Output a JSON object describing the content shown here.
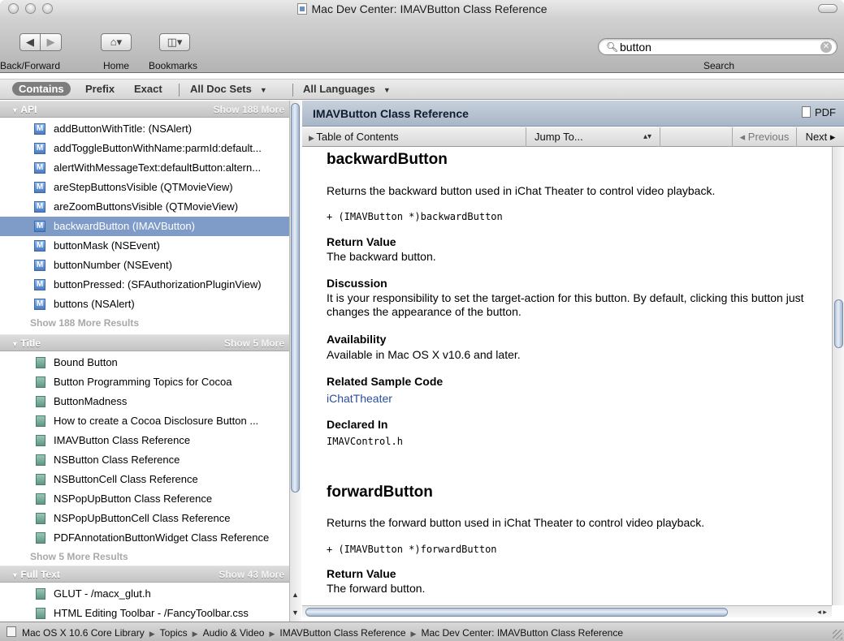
{
  "window": {
    "title": "Mac Dev Center: IMAVButton Class Reference"
  },
  "toolbar": {
    "back_forward_label": "Back/Forward",
    "home_label": "Home",
    "bookmarks_label": "Bookmarks",
    "search_label": "Search",
    "search_value": "button"
  },
  "filters": {
    "contains": "Contains",
    "prefix": "Prefix",
    "exact": "Exact",
    "doc_sets": "All Doc Sets",
    "languages": "All Languages"
  },
  "results": {
    "api": {
      "title": "API",
      "show_more_header": "Show 188 More",
      "items": [
        "addButtonWithTitle: (NSAlert)",
        "addToggleButtonWithName:parmId:default...",
        "alertWithMessageText:defaultButton:altern...",
        "areStepButtonsVisible (QTMovieView)",
        "areZoomButtonsVisible (QTMovieView)",
        "backwardButton (IMAVButton)",
        "buttonMask (NSEvent)",
        "buttonNumber (NSEvent)",
        "buttonPressed: (SFAuthorizationPluginView)",
        "buttons (NSAlert)"
      ],
      "selected_index": 5,
      "show_more_footer": "Show 188 More Results"
    },
    "title_section": {
      "title": "Title",
      "show_more_header": "Show 5 More",
      "items": [
        "Bound Button",
        "Button Programming Topics for Cocoa",
        "ButtonMadness",
        "How to create a Cocoa Disclosure Button ...",
        "IMAVButton Class Reference",
        "NSButton Class Reference",
        "NSButtonCell Class Reference",
        "NSPopUpButton Class Reference",
        "NSPopUpButtonCell Class Reference",
        "PDFAnnotationButtonWidget Class Reference"
      ],
      "show_more_footer": "Show 5 More Results"
    },
    "full_text": {
      "title": "Full Text",
      "show_more_header": "Show 43 More",
      "items": [
        "GLUT - /macx_glut.h",
        "HTML Editing Toolbar - /FancyToolbar.css"
      ]
    }
  },
  "doc": {
    "header_title": "IMAVButton Class Reference",
    "pdf_label": "PDF",
    "toc_label": "Table of Contents",
    "jump_label": "Jump To...",
    "prev_label": "◂ Previous",
    "next_label": "Next ▸",
    "sections": [
      {
        "name": "backwardButton",
        "summary": "Returns the backward button used in iChat Theater to control video playback.",
        "declaration": "+ (IMAVButton *)backwardButton",
        "return_heading": "Return Value",
        "return_text": "The backward button.",
        "discussion_heading": "Discussion",
        "discussion_text": "It is your responsibility to set the target-action for this button. By default, clicking this button just changes the appearance of the button.",
        "availability_heading": "Availability",
        "availability_text": "Available in Mac OS X v10.6 and later.",
        "sample_heading": "Related Sample Code",
        "sample_link": "iChatTheater",
        "declared_heading": "Declared In",
        "declared_text": "IMAVControl.h"
      },
      {
        "name": "forwardButton",
        "summary": "Returns the forward button used in iChat Theater to control video playback.",
        "declaration": "+ (IMAVButton *)forwardButton",
        "return_heading": "Return Value",
        "return_text": "The forward button."
      }
    ]
  },
  "pathbar": {
    "items": [
      "Mac OS X 10.6 Core Library",
      "Topics",
      "Audio & Video",
      "IMAVButton Class Reference",
      "Mac Dev Center: IMAVButton Class Reference"
    ]
  }
}
